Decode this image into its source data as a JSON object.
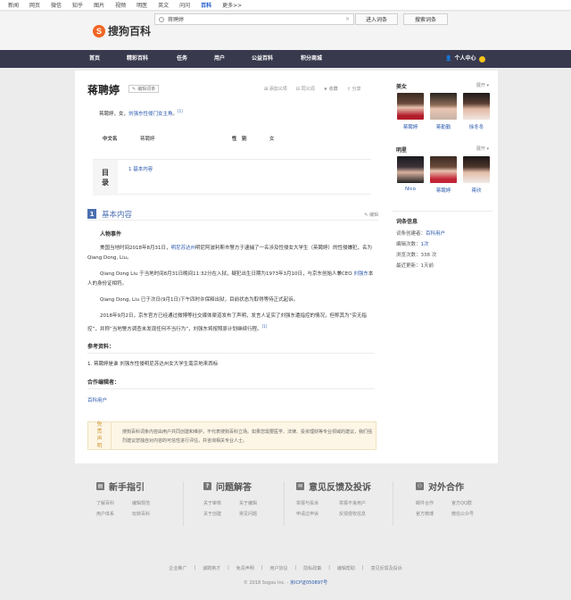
{
  "topnav": [
    "新闻",
    "网页",
    "微信",
    "知乎",
    "图片",
    "视频",
    "明医",
    "英文",
    "问问",
    "百科",
    "更多>>"
  ],
  "topnav_active": 9,
  "logo": {
    "mark": "S",
    "text": "搜狗百科"
  },
  "search": {
    "query": "蒋聘婷",
    "enter_button": "进入词条",
    "search_button": "搜索词条"
  },
  "menu": [
    "首页",
    "精彩百科",
    "任务",
    "用户",
    "公益百科",
    "积分商城"
  ],
  "user_center": "个人中心",
  "article": {
    "title": "蒋聘婷",
    "edit_entry": "编辑词条",
    "tools": [
      "添加义项",
      "同义词",
      "收藏",
      "分享"
    ],
    "summary": "蒋聘婷，女，",
    "summary_link": "刘强东性侵门女主角",
    "summary_tail": "。",
    "summary_ref": "[1]",
    "info": {
      "k1": "中文名",
      "v1": "蒋聘婷",
      "k2": "性　别",
      "v2": "女"
    },
    "toc_label_1": "目",
    "toc_label_2": "录",
    "toc_item": "1  基本内容",
    "section_num": "1",
    "section_title": "基本内容",
    "section_edit": "编辑",
    "subhead": "人物事件",
    "p1_a": "美国当地时间2018年8月31日，",
    "p1_link": "明尼苏达州",
    "p1_b": "明尼阿波利斯市警方于逮捕了一名涉及性侵女大学生（英聘婷）的性侵嫌犯，名为 Qiang Dong, Liu。",
    "p2_a": "Qiang Dong Liu 于当地时间8月31日晚间11:32分在入狱，疑犯出生日期为1973年3月10日，与京东创始人兼CEO ",
    "p2_link": "刘强东",
    "p2_b": "本人的身份证相符。",
    "p3": "Qiang Dong, Liu 已于次日(9月1日)下午四时许保释出狱，目前状态为取得等待正式起诉。",
    "p4_a": "2018年9月2日，京东官方已经通过微博等社交媒体渠道发布了声明，发言人证实了刘强东遭指控的情况，但称其为“实无指控”，并称“当地警方调查未发现任何不当行为”，刘强东将按照原计划继续行程。",
    "p4_ref": "[1]",
    "ref_head": "参考资料：",
    "ref_1": "1.  蒋聘婷是谁 刘强东性侵明尼苏达州女大学生南京地来西标",
    "collab_head": "合作编辑者：",
    "collab_user": "百科用户",
    "disclaimer_tag_1": "免",
    "disclaimer_tag_2": "责",
    "disclaimer_tag_3": "声",
    "disclaimer_tag_4": "明",
    "disclaimer_text": "搜狗百科词条内容由用户共同创建和维护，不代表搜狗百科立场。如果您需要医学、法律、投资理财等专业领域的建议，我们强烈建议您独自对内容的可信性进行评估，并咨询相关专业人士。"
  },
  "sidebar": {
    "beauty_head": "美女",
    "beauty_more": "展开",
    "beauty": [
      {
        "name": "蒋聘婷"
      },
      {
        "name": "蒋勤勤"
      },
      {
        "name": "徐冬冬"
      }
    ],
    "star_head": "明星",
    "star_more": "展开",
    "stars": [
      {
        "name": "Nico"
      },
      {
        "name": "蒋聘婷"
      },
      {
        "name": "蒋欣"
      }
    ],
    "stats_head": "词条信息",
    "creator_label": "词条创建者：",
    "creator": "百科用户",
    "edit_label": "编辑次数：",
    "edit_count": "1次",
    "views_label": "浏览次数：",
    "views": "338 次",
    "updated_label": "最近更新：",
    "updated": "1天前"
  },
  "footer": {
    "cols": [
      {
        "title": "新手指引",
        "icon": "book-icon",
        "links": [
          "了解百科",
          "编辑规范",
          "用户体系",
          "玩转百科"
        ]
      },
      {
        "title": "问题解答",
        "icon": "question-icon",
        "links": [
          "关于审核",
          "关于编辑",
          "关于创建",
          "常见问题"
        ]
      },
      {
        "title": "意见反馈及投诉",
        "icon": "feedback-icon",
        "links": [
          "举报与投诉",
          "举报不良用户",
          "申请过申诉",
          "反馈侵权信息"
        ]
      },
      {
        "title": "对外合作",
        "icon": "handshake-icon",
        "links": [
          "邮件合作",
          "官方QQ群",
          "官方微博",
          "微信公众号"
        ]
      }
    ],
    "bottom_links": [
      "企业推广",
      "诚聘英才",
      "免责声明",
      "用户协议",
      "隐私政策",
      "编辑帮助",
      "意见反馈及投诉"
    ],
    "copyright": "© 2018 Sogou Inc. - ",
    "icp": "京ICP证050897号"
  },
  "colors": {
    "menubar": "#39394e",
    "link": "#2a58ad",
    "accent": "#4a6fb1",
    "logo": "#f26522"
  }
}
